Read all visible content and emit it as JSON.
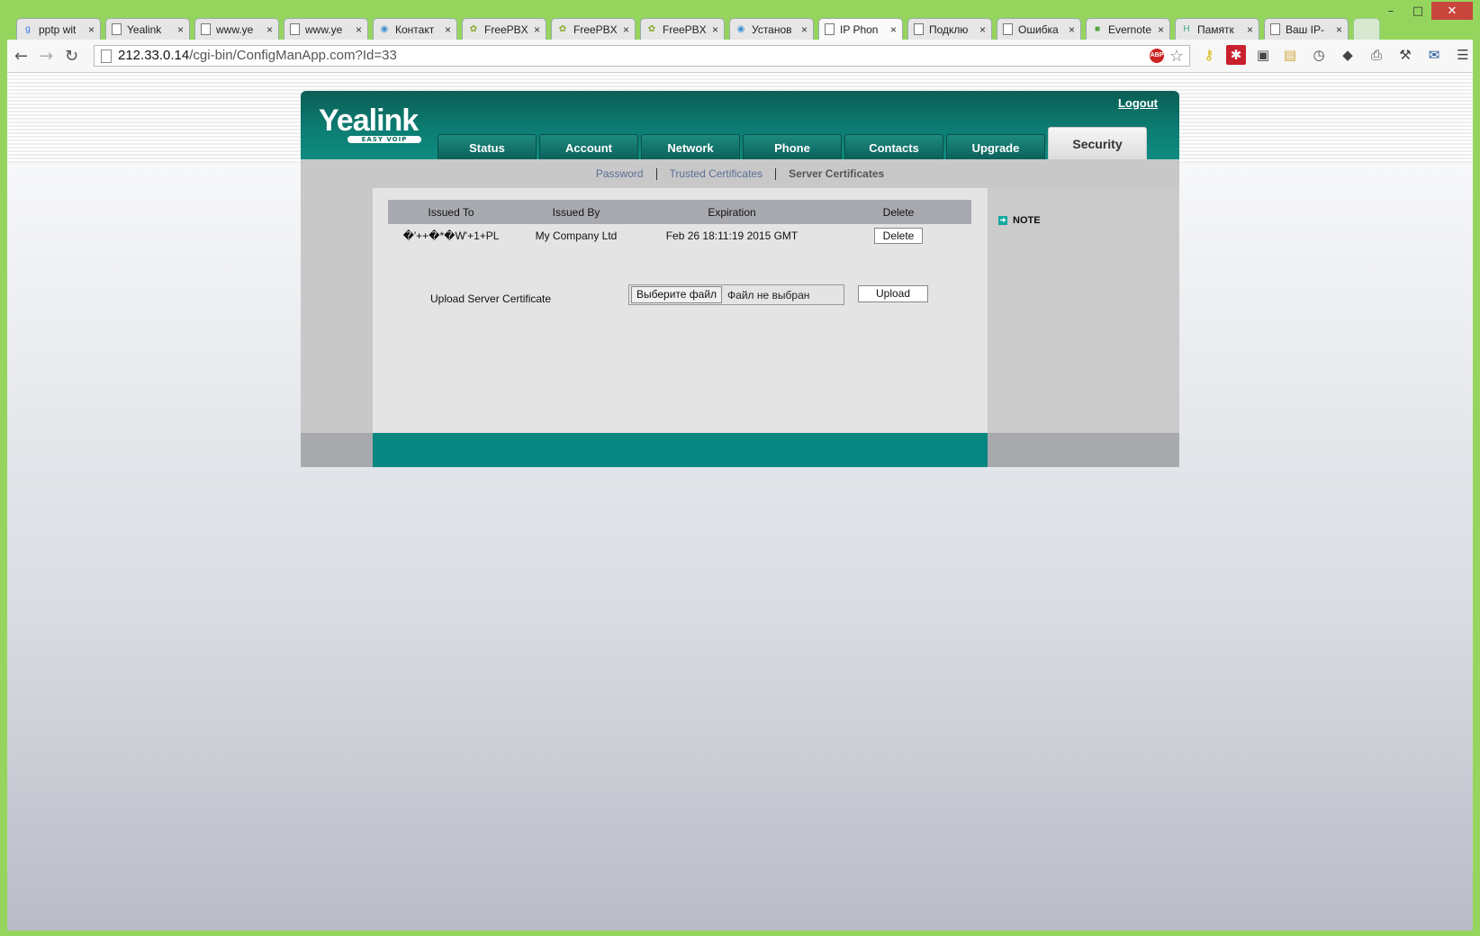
{
  "window": {
    "minimize": "–",
    "maximize": "□",
    "close": "✕"
  },
  "tabs": [
    {
      "label": "pptp wit",
      "icon": "google-icon",
      "active": false
    },
    {
      "label": "Yealink",
      "icon": "page-icon",
      "active": false
    },
    {
      "label": "www.ye",
      "icon": "page-icon",
      "active": false
    },
    {
      "label": "www.ye",
      "icon": "page-icon",
      "active": false
    },
    {
      "label": "Контакт",
      "icon": "globe-icon",
      "active": false
    },
    {
      "label": "FreePBX",
      "icon": "freepbx-icon",
      "active": false
    },
    {
      "label": "FreePBX",
      "icon": "freepbx-icon",
      "active": false
    },
    {
      "label": "FreePBX",
      "icon": "freepbx-icon",
      "active": false
    },
    {
      "label": "Установ",
      "icon": "globe-icon",
      "active": false
    },
    {
      "label": "IP Phon",
      "icon": "page-icon",
      "active": true
    },
    {
      "label": "Подклю",
      "icon": "page-icon",
      "active": false
    },
    {
      "label": "Ошибка",
      "icon": "page-icon",
      "active": false
    },
    {
      "label": "Evernote",
      "icon": "evernote-icon",
      "active": false
    },
    {
      "label": "Памятк",
      "icon": "h-icon",
      "active": false
    },
    {
      "label": "Ваш IP-",
      "icon": "page-icon",
      "active": false
    }
  ],
  "address": {
    "host": "212.33.0.14",
    "path": "/cgi-bin/ConfigManApp.com?Id=33",
    "abp": "ABP"
  },
  "yealink": {
    "logo": "Yealink",
    "logo_sub": "EASY VOIP",
    "logout": "Logout",
    "nav": [
      "Status",
      "Account",
      "Network",
      "Phone",
      "Contacts",
      "Upgrade",
      "Security"
    ],
    "active_nav": "Security",
    "subnav": {
      "password": "Password",
      "trusted": "Trusted Certificates",
      "server": "Server Certificates"
    },
    "table": {
      "headers": [
        "Issued To",
        "Issued By",
        "Expiration",
        "Delete"
      ],
      "rows": [
        {
          "issued_to": "�'++�*�W'+1+PL",
          "issued_by": "My Company Ltd",
          "expiration": "Feb 26 18:11:19 2015 GMT",
          "delete": "Delete"
        }
      ]
    },
    "upload": {
      "label": "Upload Server Certificate",
      "choose": "Выберите файл",
      "nofile": "Файл не выбран",
      "button": "Upload"
    },
    "note": "NOTE"
  },
  "colors": {
    "brand": "#0d7c72",
    "frame": "#95d55d",
    "footer": "#078781"
  }
}
